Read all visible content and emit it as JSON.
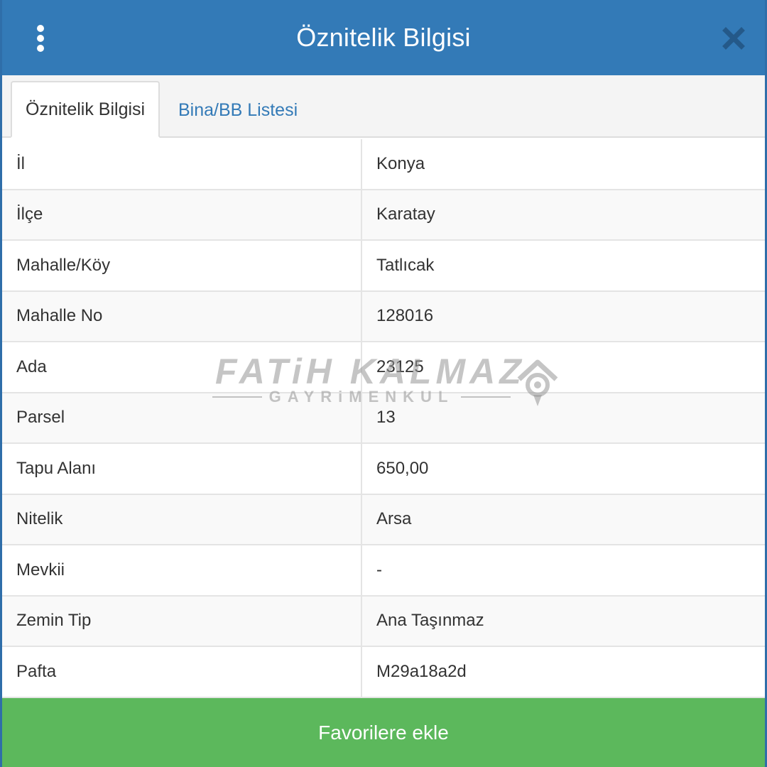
{
  "header": {
    "title": "Öznitelik Bilgisi",
    "menu_icon": "vertical-ellipsis-icon",
    "close_icon": "close-icon",
    "color": "#337ab7"
  },
  "tabs": [
    {
      "label": "Öznitelik Bilgisi",
      "active": true
    },
    {
      "label": "Bina/BB Listesi",
      "active": false
    }
  ],
  "attributes": [
    {
      "label": "İl",
      "value": "Konya"
    },
    {
      "label": "İlçe",
      "value": "Karatay"
    },
    {
      "label": "Mahalle/Köy",
      "value": "Tatlıcak"
    },
    {
      "label": "Mahalle No",
      "value": "128016"
    },
    {
      "label": "Ada",
      "value": "23125"
    },
    {
      "label": "Parsel",
      "value": "13"
    },
    {
      "label": "Tapu Alanı",
      "value": "650,00"
    },
    {
      "label": "Nitelik",
      "value": "Arsa"
    },
    {
      "label": "Mevkii",
      "value": "-"
    },
    {
      "label": "Zemin Tip",
      "value": "Ana Taşınmaz"
    },
    {
      "label": "Pafta",
      "value": "M29a18a2d"
    }
  ],
  "footer": {
    "button_label": "Favorilere ekle",
    "color": "#5cb85c"
  },
  "watermark": {
    "line1": "FATiH KALMAZ",
    "line2": "GAYRiMENKUL",
    "logo_icon": "house-logo-icon"
  }
}
